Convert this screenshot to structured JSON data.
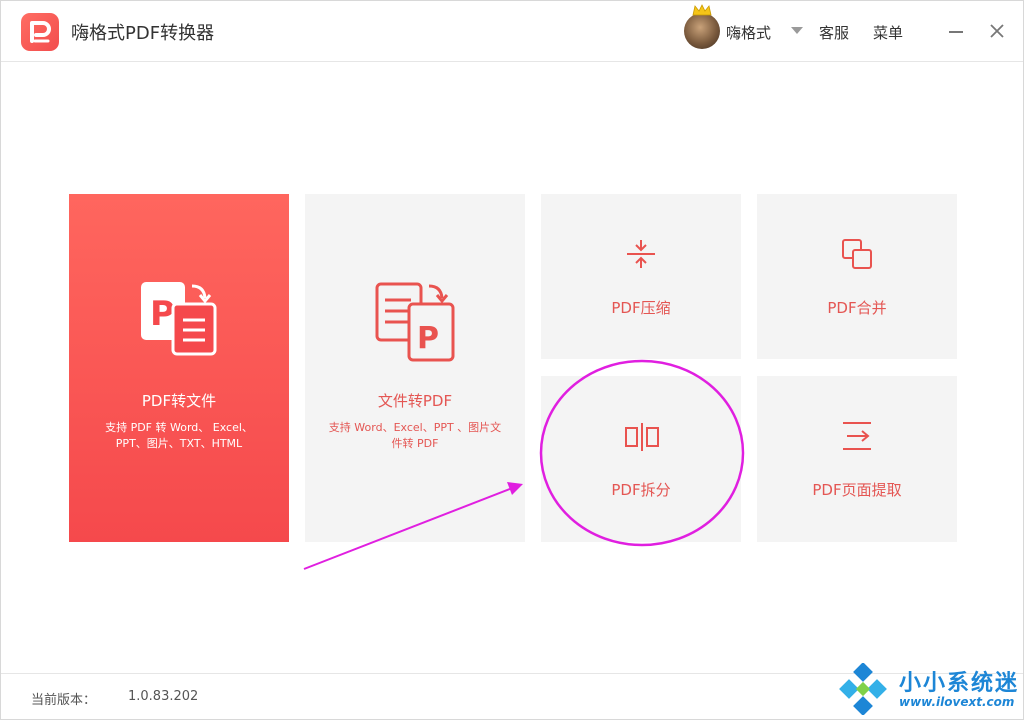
{
  "header": {
    "app_title": "嗨格式PDF转换器",
    "username": "嗨格式",
    "service_label": "客服",
    "menu_label": "菜单"
  },
  "cards": {
    "pdf_to_file": {
      "title": "PDF转文件",
      "desc_line1": "支持 PDF 转 Word、 Excel、",
      "desc_line2": "PPT、图片、TXT、HTML"
    },
    "file_to_pdf": {
      "title": "文件转PDF",
      "desc_line1": "支持 Word、Excel、PPT 、图片文",
      "desc_line2": "件转 PDF"
    },
    "compress": {
      "title": "PDF压缩"
    },
    "merge": {
      "title": "PDF合并"
    },
    "split": {
      "title": "PDF拆分"
    },
    "extract": {
      "title": "PDF页面提取"
    }
  },
  "footer": {
    "version_label": "当前版本：",
    "version_value": "1.0.83.202"
  },
  "watermark": {
    "title": "小小系统迷",
    "url": "www.ilovext.com"
  },
  "colors": {
    "accent": "#f24d4d",
    "card_bg": "#f4f4f4",
    "annotation": "#e01fe0",
    "watermark": "#1d86d6"
  },
  "icons": {
    "logo": "app-logo-icon",
    "minimize": "minimize-icon",
    "close": "close-icon",
    "compress": "compress-icon",
    "merge": "merge-icon",
    "split": "split-icon",
    "extract": "extract-icon"
  }
}
